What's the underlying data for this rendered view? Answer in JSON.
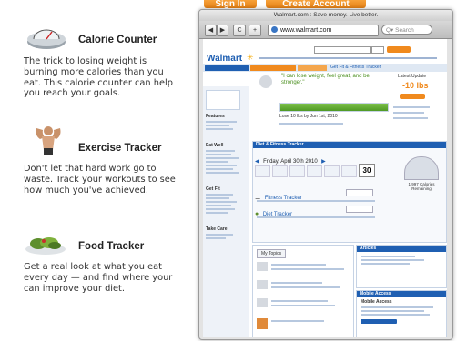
{
  "top_buttons": {
    "sign_in": "Sign In",
    "create_account": "Create Account"
  },
  "features": [
    {
      "title": "Calorie Counter",
      "icon": "scale-icon",
      "description": "The trick to losing weight is burning more calories than you eat. This calorie counter can help you reach your goals."
    },
    {
      "title": "Exercise Tracker",
      "icon": "strongman-icon",
      "description": "Don't let that hard work go to waste. Track your workouts to see how much you've achieved."
    },
    {
      "title": "Food Tracker",
      "icon": "salad-icon",
      "description": "Get a real look at what you eat every day — and find where your can improve your diet."
    }
  ],
  "browser": {
    "window_title": "Walmart.com : Save money. Live better.",
    "nav": {
      "back": "◀",
      "forward": "▶",
      "reload": "C",
      "add": "+"
    },
    "url": "www.walmart.com",
    "search_placeholder": "Q▾ Search"
  },
  "walmart": {
    "logo": "Walmart",
    "tab_active": "Tab Active",
    "breadcrumb": "Get Fit & Fitness Tracker",
    "quote": "\"I can lose weight, feel great, and be stronger.\"",
    "latest_update": "Latest Update",
    "update_value": "-10 lbs",
    "goal_text": "Lose 10 lbs by Jun 1st, 2010",
    "tracker_header": "Diet & Fitness Tracker",
    "date_label": "Friday, April 30th 2010",
    "calendar_day": "30",
    "calories_remaining": "1,997 Calories Remaining",
    "fitness_tracker": "Fitness Tracker",
    "diet_tracker": "Diet Tracker",
    "my_topics": "My Topics",
    "articles": "Articles",
    "mobile_access": "Mobile Access",
    "mobile_sub": "Mobile Access",
    "sidebar_sections": [
      "Features",
      "Eat Well",
      "Get Fit",
      "Take Care"
    ]
  },
  "colors": {
    "accent_orange": "#f08a1e",
    "walmart_blue": "#1f5fb2",
    "link_blue": "#2f5fa7"
  }
}
